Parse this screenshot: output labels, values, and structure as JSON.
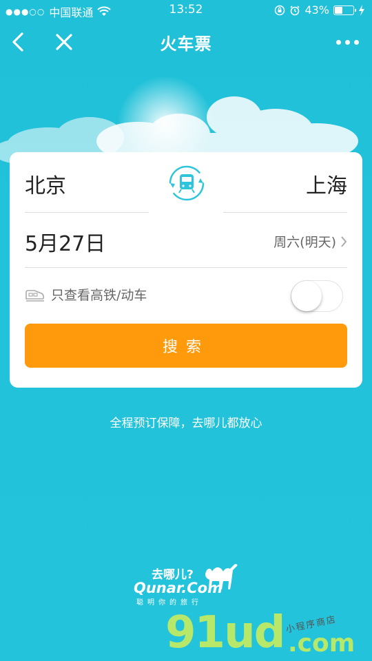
{
  "status_bar": {
    "signal_dots": "●●●○○",
    "carrier": "中国联通",
    "time": "13:52",
    "battery_percent": "43%",
    "battery_level": 0.43
  },
  "nav": {
    "title": "火车票"
  },
  "card": {
    "from_city": "北京",
    "to_city": "上海",
    "date": "5月27日",
    "weekday": "周六(明天)",
    "filter_label": "只查看高铁/动车",
    "filter_on": false,
    "search_label": "搜索"
  },
  "slogan": "全程预订保障，去哪儿都放心",
  "logo": {
    "cn": "去哪儿?",
    "en": "Qunar.Com",
    "sub": "聪明你的旅行"
  },
  "watermark": {
    "big": "91ud",
    "com": ".com",
    "small": "小程序商店"
  },
  "colors": {
    "background": "#22c2da",
    "accent": "#ff9a0c",
    "icon_teal": "#2ec4dc"
  }
}
